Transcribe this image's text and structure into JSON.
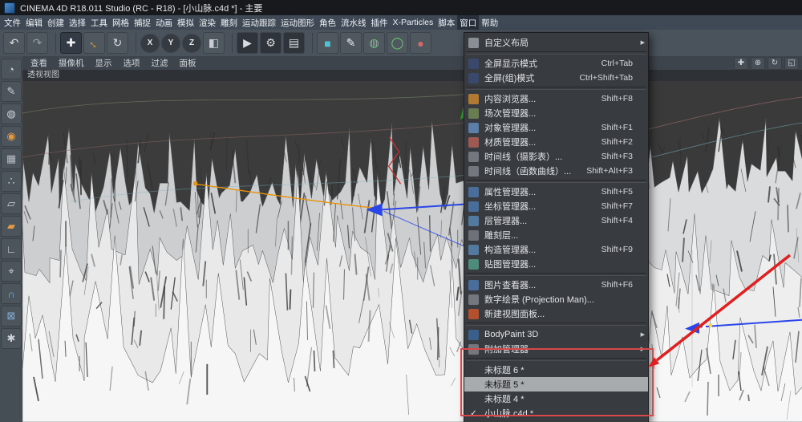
{
  "titlebar": {
    "title": "CINEMA 4D R18.011 Studio (RC - R18) - [小山脉.c4d *] - 主要"
  },
  "menubar": {
    "active": "窗口",
    "items": [
      "文件",
      "编辑",
      "创建",
      "选择",
      "工具",
      "网格",
      "捕捉",
      "动画",
      "模拟",
      "渲染",
      "雕刻",
      "运动跟踪",
      "运动图形",
      "角色",
      "流水线",
      "插件",
      "X-Particles",
      "脚本",
      "窗口",
      "帮助"
    ]
  },
  "toolbar": {
    "items": [
      {
        "name": "undo-button",
        "glyph": "↶",
        "color": "#d8dcdf"
      },
      {
        "name": "redo-button",
        "glyph": "↷",
        "color": "#989ea4"
      },
      {
        "name": "separator"
      },
      {
        "name": "move-tool",
        "glyph": "✚",
        "color": "#f0f2f4",
        "active": true
      },
      {
        "name": "scale-tool",
        "glyph": "↔",
        "color": "#e8a13c",
        "rotate": true
      },
      {
        "name": "rotate-tool",
        "glyph": "↻",
        "color": "#d8dcdf"
      },
      {
        "name": "separator"
      },
      {
        "name": "lock-x-axis-button",
        "glyph": "X",
        "round": true
      },
      {
        "name": "lock-y-axis-button",
        "glyph": "Y",
        "round": true
      },
      {
        "name": "lock-z-axis-button",
        "glyph": "Z",
        "round": true
      },
      {
        "name": "coordinate-system-button",
        "glyph": "◧",
        "color": "#c9ced3"
      },
      {
        "name": "separator"
      },
      {
        "name": "render-active-view-button",
        "glyph": "▶",
        "color": "#d9dde0",
        "dark": true
      },
      {
        "name": "render-settings-button",
        "glyph": "⚙",
        "color": "#d9dde0",
        "dark": true
      },
      {
        "name": "render-picture-viewer-button",
        "glyph": "▤",
        "color": "#d9dde0",
        "dark": true
      },
      {
        "name": "separator"
      },
      {
        "name": "primitive-cube-button",
        "glyph": "■",
        "color": "#4fc3d6"
      },
      {
        "name": "pen-spline-button",
        "glyph": "✎",
        "color": "#e9ecee"
      },
      {
        "name": "subdivision-surface-button",
        "glyph": "◍",
        "color": "#6fcf73"
      },
      {
        "name": "instance-button",
        "glyph": "◯",
        "color": "#6fcf73"
      },
      {
        "name": "metaball-button",
        "glyph": "●",
        "color": "#d46a6a"
      }
    ]
  },
  "sidebar": {
    "items": [
      {
        "name": "layout-sphere-icon",
        "glyph": "◔",
        "color": "#cfd4d8"
      },
      {
        "name": "make-editable-button",
        "glyph": "✎",
        "color": "#cfd4d8"
      },
      {
        "name": "model-mode-button",
        "glyph": "◍",
        "color": "#cfd4d8"
      },
      {
        "name": "texture-mode-button",
        "glyph": "◉",
        "color": "#e09a4a"
      },
      {
        "name": "workplane-mode-button",
        "glyph": "▦",
        "color": "#b9bec2"
      },
      {
        "name": "points-mode-button",
        "glyph": "∴",
        "color": "#cfd4d8"
      },
      {
        "name": "edges-mode-button",
        "glyph": "▱",
        "color": "#cfd4d8"
      },
      {
        "name": "polygons-mode-button",
        "glyph": "▰",
        "color": "#e09a4a"
      },
      {
        "name": "enable-axis-button",
        "glyph": "∟",
        "color": "#cfd4d8"
      },
      {
        "name": "viewport-solo-button",
        "glyph": "⌖",
        "color": "#cfd4d8"
      },
      {
        "name": "enable-snap-button",
        "glyph": "∩",
        "color": "#7fb2e0"
      },
      {
        "name": "lock-workplane-button",
        "glyph": "⊠",
        "color": "#7fb2e0"
      },
      {
        "name": "quantize-button",
        "glyph": "✱",
        "color": "#cfd4d8"
      }
    ]
  },
  "viewport_menubar": {
    "items": [
      "查看",
      "摄像机",
      "显示",
      "选项",
      "过滤",
      "面板"
    ],
    "nav": [
      {
        "name": "pan-view-icon",
        "glyph": "✚"
      },
      {
        "name": "zoom-view-icon",
        "glyph": "⊕"
      },
      {
        "name": "rotate-view-icon",
        "glyph": "↻"
      },
      {
        "name": "toggle-view-icon",
        "glyph": "◱"
      }
    ]
  },
  "viewport": {
    "label": "透视视图"
  },
  "window_menu": {
    "items": [
      {
        "label": "自定义布局",
        "arrow": true,
        "icon": "#8a8f96"
      },
      {
        "sep": true
      },
      {
        "label": "全屏显示模式",
        "shortcut": "Ctrl+Tab",
        "icon": "#39486b"
      },
      {
        "label": "全屏(组)模式",
        "shortcut": "Ctrl+Shift+Tab",
        "icon": "#39486b"
      },
      {
        "sep": true
      },
      {
        "label": "内容浏览器...",
        "shortcut": "Shift+F8",
        "icon": "#b07a35"
      },
      {
        "label": "场次管理器...",
        "icon": "#6a7d52"
      },
      {
        "label": "对象管理器...",
        "shortcut": "Shift+F1",
        "icon": "#5b7fa6"
      },
      {
        "label": "材质管理器...",
        "shortcut": "Shift+F2",
        "icon": "#9c5a52"
      },
      {
        "label": "时间线（摄影表）...",
        "shortcut": "Shift+F3",
        "icon": "#74787e"
      },
      {
        "label": "时间线（函数曲线）...",
        "shortcut": "Shift+Alt+F3",
        "icon": "#74787e"
      },
      {
        "sep": true
      },
      {
        "label": "属性管理器...",
        "shortcut": "Shift+F5",
        "icon": "#4a6e99"
      },
      {
        "label": "坐标管理器...",
        "shortcut": "Shift+F7",
        "icon": "#4a6e99"
      },
      {
        "label": "层管理器...",
        "shortcut": "Shift+F4",
        "icon": "#537a9e"
      },
      {
        "label": "雕刻层...",
        "icon": "#6e7278"
      },
      {
        "label": "构造管理器...",
        "shortcut": "Shift+F9",
        "icon": "#537a9e"
      },
      {
        "label": "贴图管理器...",
        "icon": "#4f8a7a"
      },
      {
        "sep": true
      },
      {
        "label": "图片查看器...",
        "shortcut": "Shift+F6",
        "icon": "#4a6e99"
      },
      {
        "label": "数字绘景 (Projection Man)...",
        "icon": "#74787e"
      },
      {
        "label": "新建视图面板...",
        "icon": "#b0512f"
      },
      {
        "sep": true
      },
      {
        "label": "BodyPaint 3D",
        "arrow": true,
        "icon": "#3a5f8a"
      },
      {
        "label": "附加管理器",
        "arrow": true,
        "icon": "#74787e"
      },
      {
        "sep": true
      },
      {
        "label": "未标题 6 *"
      },
      {
        "label": "未标题 5 *",
        "highlighted": true
      },
      {
        "label": "未标题 4 *"
      },
      {
        "label": "小山脉.c4d *",
        "checked": true
      }
    ]
  },
  "annotations": {
    "arrow_color": "#e02020",
    "box_color": "#d84848",
    "check_glyph": "✓",
    "submenu_glyph": "▶"
  }
}
